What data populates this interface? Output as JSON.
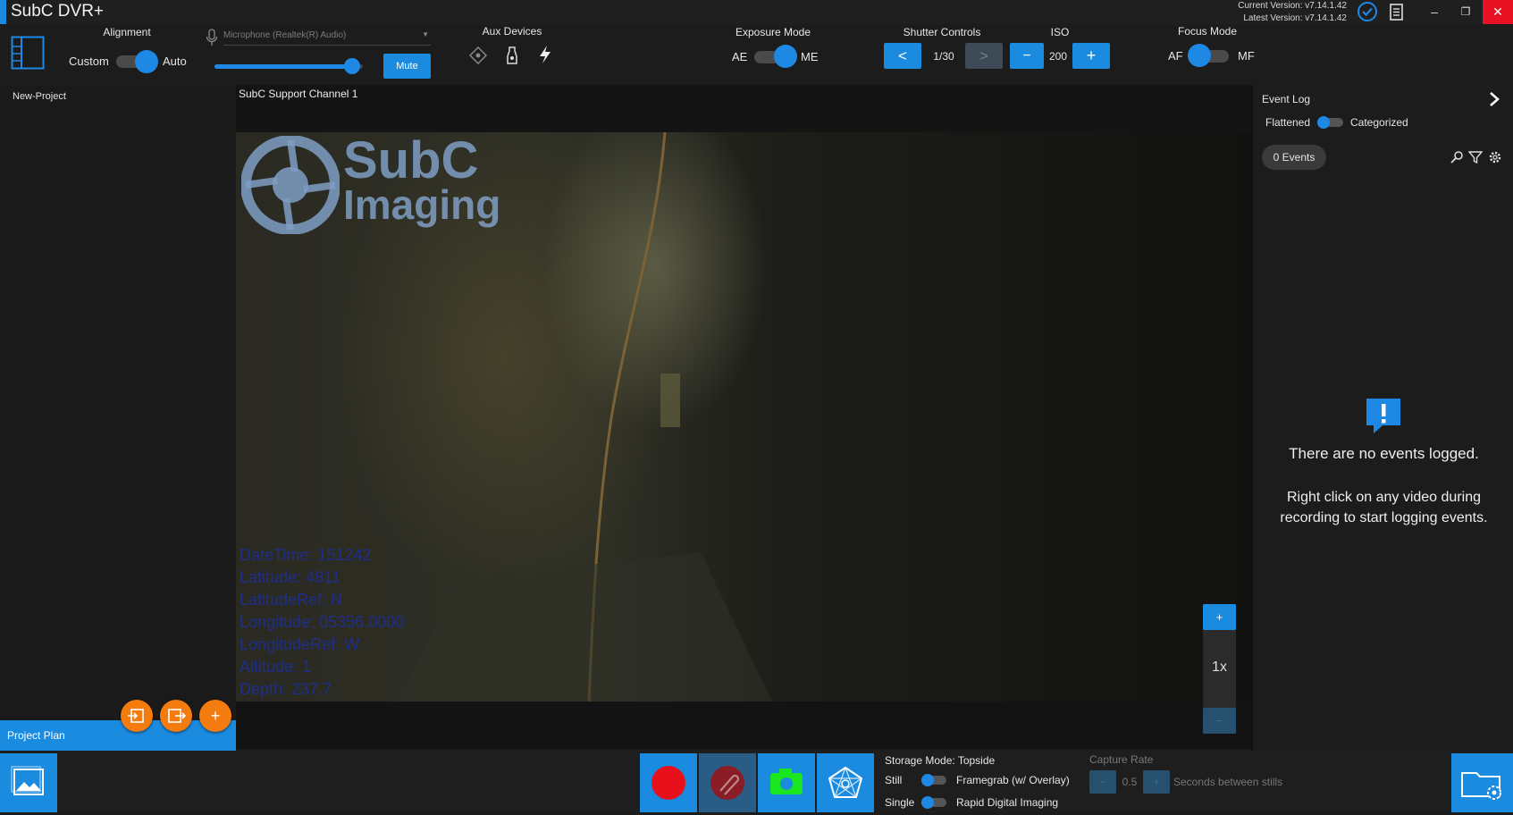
{
  "titlebar": {
    "app_title": "SubC DVR+",
    "current_version": "Current Version: v7.14.1.42",
    "latest_version": "Latest Version: v7.14.1.42",
    "minimize": "–",
    "restore": "❐",
    "close": "✕"
  },
  "toolbar": {
    "alignment": {
      "label": "Alignment",
      "left": "Custom",
      "right": "Auto",
      "state": "Auto"
    },
    "audio": {
      "placeholder": "Microphone (Realtek(R) Audio)",
      "level": 0.93,
      "mute_label": "Mute"
    },
    "aux": {
      "label": "Aux Devices"
    },
    "exposure": {
      "label": "Exposure Mode",
      "left": "AE",
      "right": "ME",
      "state": "ME"
    },
    "shutter": {
      "label": "Shutter Controls",
      "prev": "<",
      "value": "1/30",
      "next": ">"
    },
    "iso": {
      "label": "ISO",
      "minus": "−",
      "value": "200",
      "plus": "+"
    },
    "focus": {
      "label": "Focus Mode",
      "left": "AF",
      "right": "MF",
      "state": "AF"
    }
  },
  "left_panel": {
    "project_name": "New-Project",
    "project_plan": "Project Plan",
    "add_label": "+"
  },
  "video": {
    "channel": "SubC Support Channel 1",
    "logo_top": "SubC",
    "logo_bottom": "Imaging",
    "overlay": [
      "DateTime: 151242",
      "Latitude: 4811",
      "LatitudeRef: N",
      "Longitude: 05356.0000",
      "LongitudeRef: W",
      "Altitude: 1",
      "Depth: 237.7"
    ],
    "zoom_in": "+",
    "zoom_value": "1x",
    "zoom_out": "−"
  },
  "event_log": {
    "title": "Event Log",
    "flattened": "Flattened",
    "categorized": "Categorized",
    "events_count": "0",
    "events_label": "Events",
    "empty_title": "There are no events logged.",
    "empty_hint_1": "Right click on any video during",
    "empty_hint_2": "recording to start logging events."
  },
  "bottom": {
    "storage_mode": "Storage Mode: Topside",
    "still": "Still",
    "single": "Single",
    "framegrab": "Framegrab (w/ Overlay)",
    "rdi": "Rapid Digital Imaging",
    "capture_rate": "Capture Rate",
    "rate_value": "0.5",
    "rate_unit": "Seconds between stills",
    "rate_minus": "−",
    "rate_plus": "+"
  },
  "colors": {
    "accent": "#1b8be0",
    "orange": "#f47c0e",
    "record": "#e8101a",
    "camera": "#19e61e",
    "close": "#e81123"
  }
}
